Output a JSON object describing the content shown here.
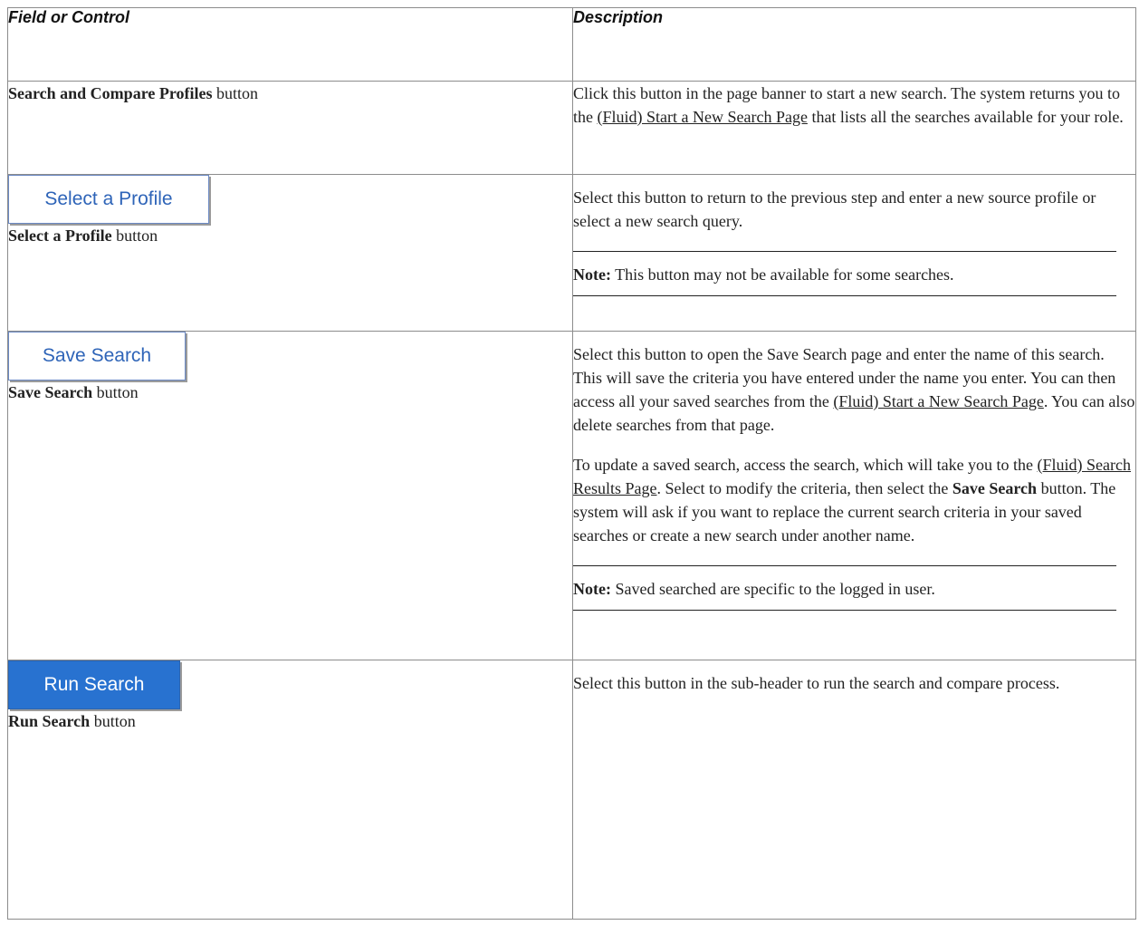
{
  "table": {
    "header": {
      "col1": "Field or Control",
      "col2": "Description"
    },
    "rows": [
      {
        "field_bold": "Search and Compare Profiles",
        "field_suffix": " button",
        "desc_before_link": "Click this button in the page banner to start a new search. The system returns you to the ",
        "desc_link": "(Fluid) Start a New Search Page",
        "desc_after_link": " that lists all the searches available for your role."
      },
      {
        "button_label": "Select a Profile",
        "field_bold": "Select a Profile",
        "field_suffix": " button",
        "desc": "Select this button to return to the previous step and enter a new source profile or select a new search query.",
        "note_label": "Note:",
        "note_text": " This button may not be available for some searches."
      },
      {
        "button_label": "Save Search",
        "field_bold": "Save Search",
        "field_suffix": " button",
        "desc1_before_link": "Select this button to open the Save Search page and enter the name of this search. This will save the criteria you have entered under the name you enter. You can then access all your saved searches from the ",
        "desc1_link": "(Fluid) Start a New Search Page",
        "desc1_after_link": ". You can also delete searches from that page.",
        "desc2_before_link": "To update a saved search, access the search, which will take you to the ",
        "desc2_link": "(Fluid) Search Results Page",
        "desc2_mid": ". Select to modify the criteria, then select the ",
        "desc2_bold": "Save Search",
        "desc2_after": " button. The system will ask if you want to replace the current search criteria in your saved searches or create a new search under another name.",
        "note_label": "Note:",
        "note_text": " Saved searched are specific to the logged in user."
      },
      {
        "button_label": "Run Search",
        "field_bold": "Run Search",
        "field_suffix": " button",
        "desc": "Select this button in the sub-header to run the search and compare process."
      }
    ]
  },
  "colors": {
    "button_text": "#2e64b8",
    "primary_button_bg": "#2872d0",
    "border": "#8c8c8c"
  }
}
